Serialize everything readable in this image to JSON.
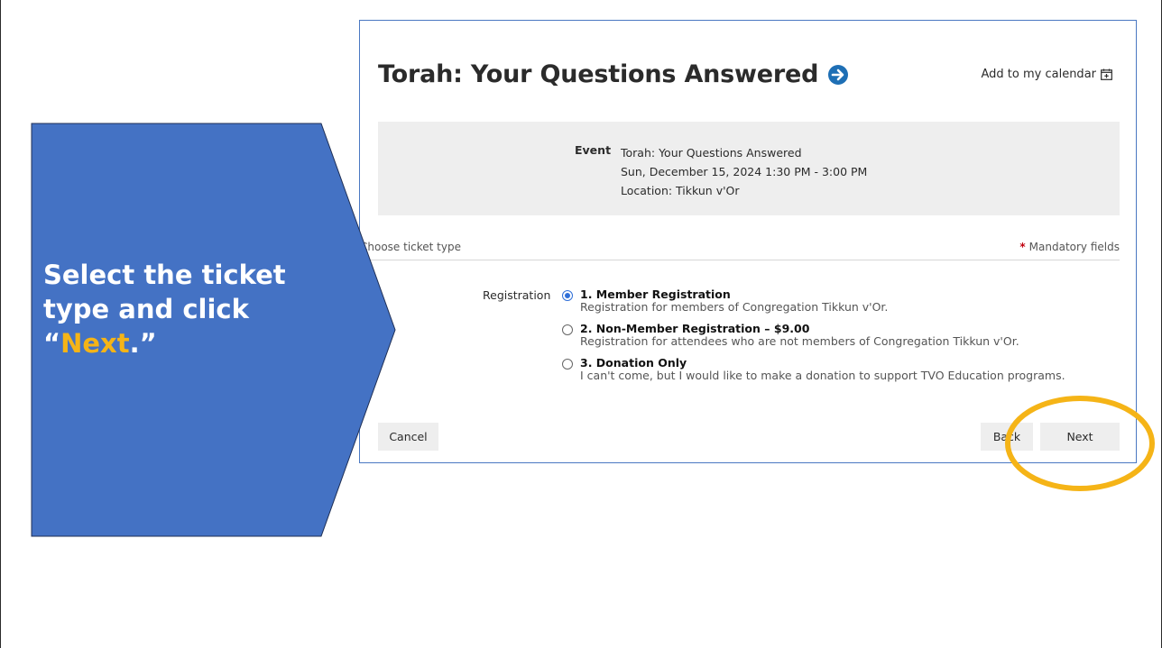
{
  "event_page": {
    "title": "Torah: Your Questions Answered",
    "add_to_calendar": "Add to my calendar",
    "event_label": "Event",
    "event_name": "Torah: Your Questions Answered",
    "event_datetime": "Sun, December 15, 2024 1:30 PM - 3:00 PM",
    "event_location": "Location: Tikkun v'Or",
    "choose_ticket_type": "Choose ticket type",
    "mandatory_fields": "Mandatory fields",
    "registration_label": "Registration",
    "options": [
      {
        "title": "1. Member Registration",
        "desc": "Registration for members of Congregation Tikkun v'Or.",
        "checked": true
      },
      {
        "title": "2. Non-Member Registration – $9.00",
        "desc": "Registration for attendees who are not members of Congregation Tikkun v'Or.",
        "checked": false
      },
      {
        "title": "3. Donation Only",
        "desc": "I can't come, but I would like to make a donation to support TVO Education programs.",
        "checked": false
      }
    ],
    "buttons": {
      "cancel": "Cancel",
      "back": "Back",
      "next": "Next"
    }
  },
  "callout": {
    "text_before": "Select the ticket type and click “",
    "highlight": "Next",
    "text_after": ".”",
    "fill_color": "#4472c4",
    "highlight_color": "#f5b417"
  },
  "colors": {
    "ring": "#f5b417",
    "radio_checked": "#2f6fd8",
    "title_arrow": "#1e6fb5"
  }
}
